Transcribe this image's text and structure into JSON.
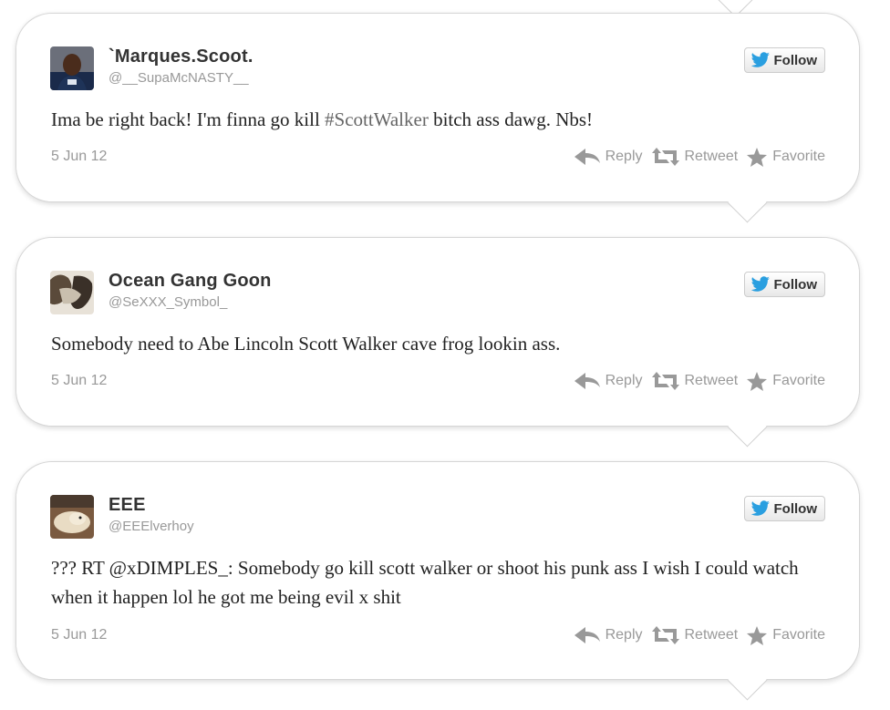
{
  "tweets": [
    {
      "name": "`Marques.Scoot.",
      "handle": "@__SupaMcNASTY__",
      "text_before": "Ima be right back! I'm finna go kill ",
      "hashtag": "#ScottWalker",
      "text_after": " bitch ass dawg. Nbs!",
      "date": "5 Jun 12",
      "avatar_icon": "person-avatar"
    },
    {
      "name": "Ocean Gang Goon",
      "handle": "@SeXXX_Symbol_",
      "text": "Somebody need to Abe Lincoln Scott Walker cave frog lookin ass.",
      "date": "5 Jun 12",
      "avatar_icon": "photo-avatar"
    },
    {
      "name": "EEE",
      "handle": "@EEElverhoy",
      "text": "??? RT @xDIMPLES_: Somebody go kill scott walker or shoot his punk ass I wish I could watch when it happen lol he got me being evil x shit",
      "date": "5 Jun 12",
      "avatar_icon": "dog-avatar"
    }
  ],
  "labels": {
    "follow": "Follow",
    "reply": "Reply",
    "retweet": "Retweet",
    "favorite": "Favorite"
  },
  "colors": {
    "twitter_bird": "#2a9fe0",
    "action_gray": "#999999"
  }
}
